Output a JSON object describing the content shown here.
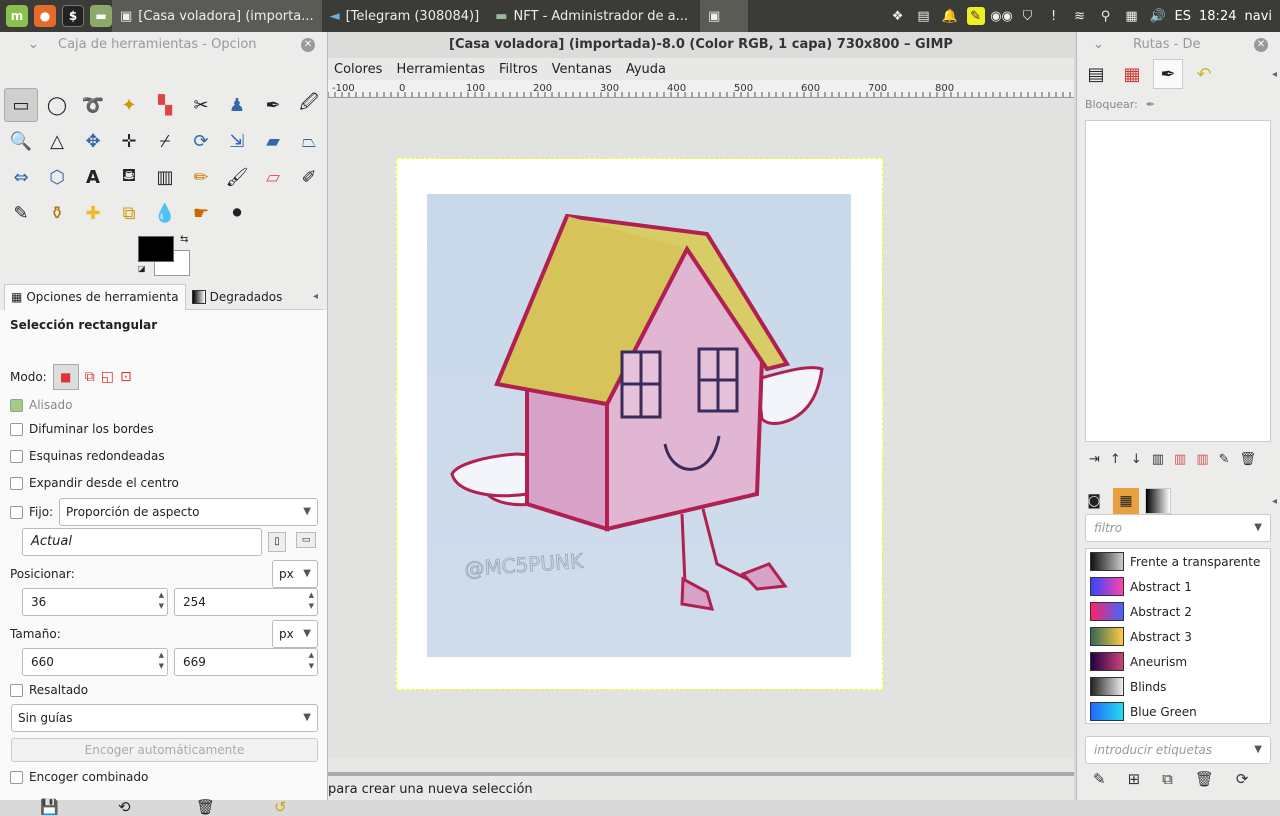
{
  "topbar": {
    "tasks": [
      {
        "label": "[Casa voladora] (importa...",
        "active": true
      },
      {
        "label": "[Telegram (308084)]",
        "active": false
      },
      {
        "label": "NFT - Administrador de a...",
        "active": false
      }
    ],
    "lang": "ES",
    "time": "18:24",
    "user": "navi"
  },
  "image_window": {
    "title": "[Casa voladora] (importada)-8.0 (Color RGB, 1 capa) 730x800 – GIMP",
    "menus": [
      "Colores",
      "Herramientas",
      "Filtros",
      "Ventanas",
      "Ayuda"
    ],
    "ruler_ticks": [
      "-100",
      "0",
      "100",
      "200",
      "300",
      "400",
      "500",
      "600",
      "700",
      "800"
    ],
    "watermark": "@MC5PUNK",
    "status": "para crear una nueva selección"
  },
  "toolbox": {
    "title": "Caja de herramientas - Opcion",
    "tabs": [
      "Opciones de herramienta",
      "Degradados"
    ],
    "options": {
      "heading": "Selección rectangular",
      "mode_label": "Modo:",
      "antialias": "Alisado",
      "feather": "Difuminar los bordes",
      "rounded": "Esquinas redondeadas",
      "expand": "Expandir desde el centro",
      "fixed_label": "Fijo:",
      "fixed_value": "Proporción de aspecto",
      "current": "Actual",
      "position_label": "Posicionar:",
      "position_unit": "px",
      "pos_x": "36",
      "pos_y": "254",
      "size_label": "Tamaño:",
      "size_unit": "px",
      "size_w": "660",
      "size_h": "669",
      "highlight": "Resaltado",
      "guides": "Sin guías",
      "autoshrink": "Encoger automáticamente",
      "shrink_merged": "Encoger combinado"
    }
  },
  "right_dock": {
    "title": "Rutas - De",
    "lock_label": "Bloquear:",
    "filter_placeholder": "filtro",
    "gradients": [
      {
        "name": "Frente a transparente",
        "colors": [
          "#111",
          "#ccc"
        ]
      },
      {
        "name": "Abstract 1",
        "colors": [
          "#3344ff",
          "#ff44aa"
        ]
      },
      {
        "name": "Abstract 2",
        "colors": [
          "#ff2266",
          "#4466ff"
        ]
      },
      {
        "name": "Abstract 3",
        "colors": [
          "#336655",
          "#ffcc44"
        ]
      },
      {
        "name": "Aneurism",
        "colors": [
          "#220044",
          "#cc4477"
        ]
      },
      {
        "name": "Blinds",
        "colors": [
          "#222",
          "#eee"
        ]
      },
      {
        "name": "Blue Green",
        "colors": [
          "#2266ff",
          "#22ddee"
        ]
      }
    ],
    "tags_placeholder": "introducir etiquetas"
  }
}
